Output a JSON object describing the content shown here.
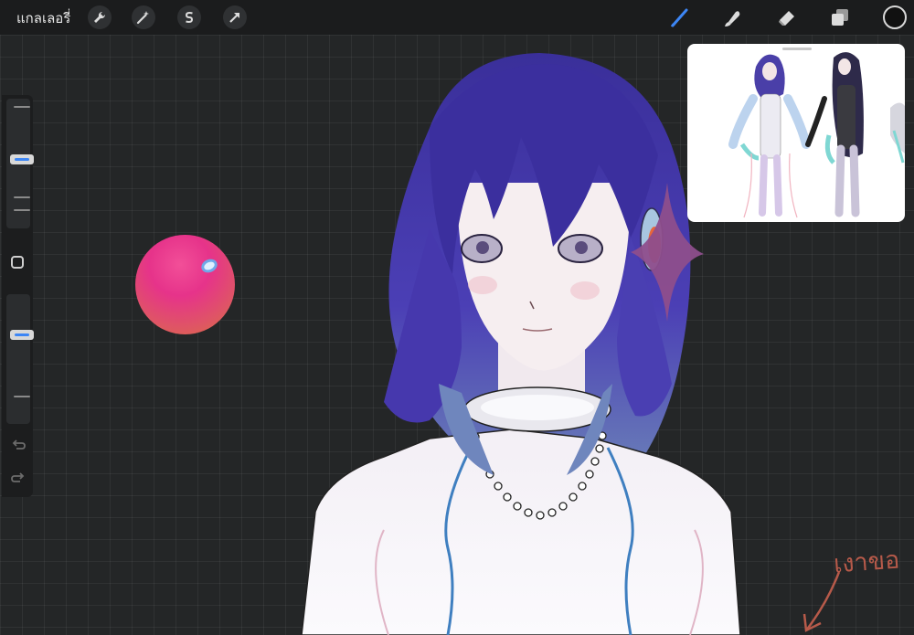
{
  "topbar": {
    "gallery_label": "แกลเลอรี่",
    "left_tools": [
      {
        "name": "actions",
        "icon": "wrench-icon"
      },
      {
        "name": "adjustments",
        "icon": "magic-wand-icon"
      },
      {
        "name": "selection",
        "icon": "selection-s-icon"
      },
      {
        "name": "transform",
        "icon": "arrow-cursor-icon"
      }
    ],
    "right_tools": [
      {
        "name": "brush",
        "icon": "brush-icon",
        "active": true
      },
      {
        "name": "smudge",
        "icon": "smudge-icon",
        "active": false
      },
      {
        "name": "eraser",
        "icon": "eraser-icon",
        "active": false
      },
      {
        "name": "layers",
        "icon": "layers-icon",
        "active": false
      }
    ],
    "current_color": "#111111",
    "accent_color": "#3d86f5"
  },
  "sidebar": {
    "brush_size_level": 0.75,
    "opacity_level": 0.68
  },
  "canvas": {
    "annotation_text": "เงาขอ"
  }
}
